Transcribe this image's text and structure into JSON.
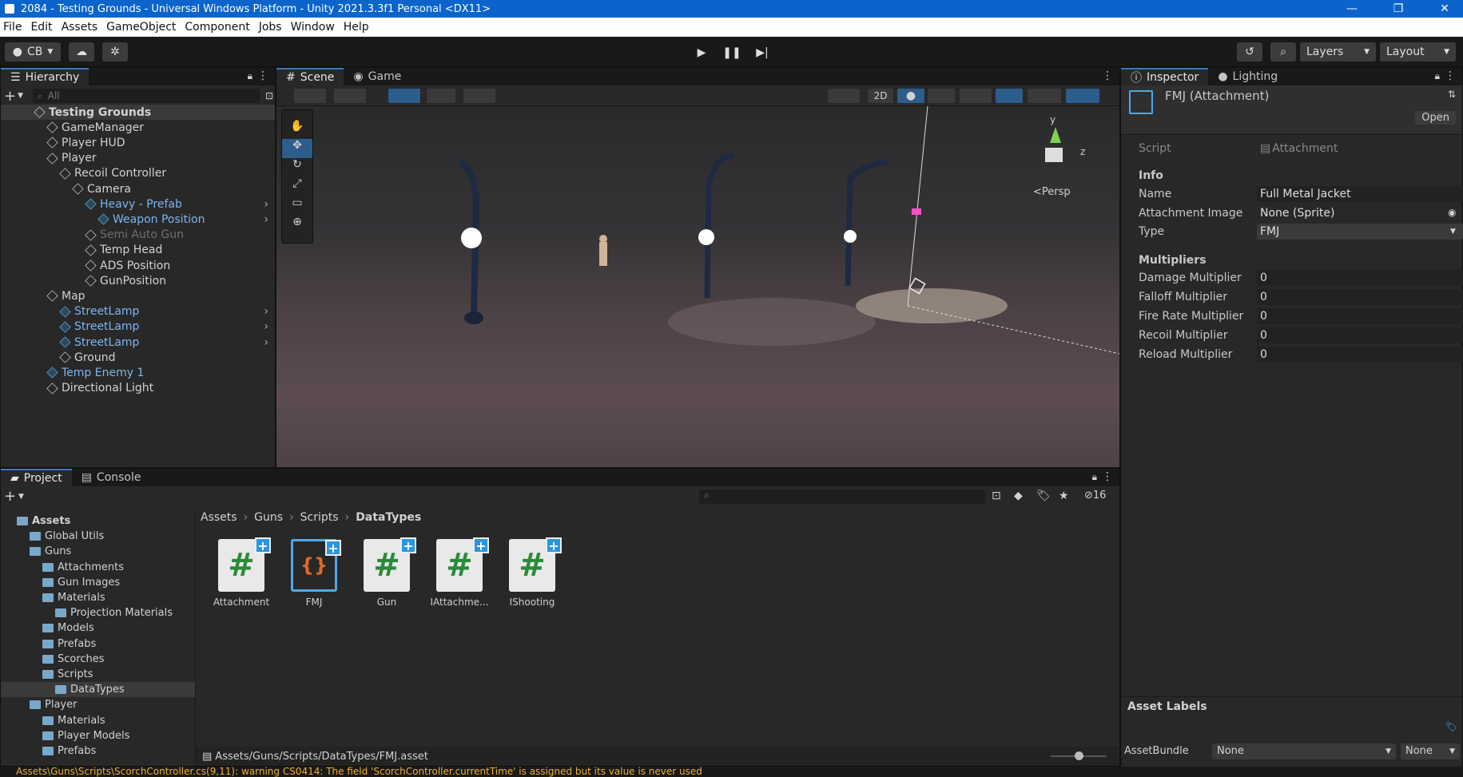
{
  "window": {
    "title": "2084 - Testing Grounds - Universal Windows Platform - Unity 2021.3.3f1 Personal <DX11>"
  },
  "menu": [
    "File",
    "Edit",
    "Assets",
    "GameObject",
    "Component",
    "Jobs",
    "Window",
    "Help"
  ],
  "toolbar": {
    "account": "CB",
    "layers": "Layers",
    "layout": "Layout"
  },
  "hierarchy": {
    "tab": "Hierarchy",
    "search_placeholder": "All",
    "rows": [
      {
        "label": "Testing Grounds",
        "depth": 0,
        "kind": "scene"
      },
      {
        "label": "GameManager",
        "depth": 1
      },
      {
        "label": "Player HUD",
        "depth": 1
      },
      {
        "label": "Player",
        "depth": 1
      },
      {
        "label": "Recoil Controller",
        "depth": 2
      },
      {
        "label": "Camera",
        "depth": 3
      },
      {
        "label": "Heavy - Prefab",
        "depth": 4,
        "kind": "prefab"
      },
      {
        "label": "Weapon Position",
        "depth": 5,
        "kind": "prefab"
      },
      {
        "label": "Semi Auto Gun",
        "depth": 4,
        "kind": "dim"
      },
      {
        "label": "Temp Head",
        "depth": 4
      },
      {
        "label": "ADS Position",
        "depth": 4
      },
      {
        "label": "GunPosition",
        "depth": 4
      },
      {
        "label": "Map",
        "depth": 1
      },
      {
        "label": "StreetLamp",
        "depth": 2,
        "kind": "prefab"
      },
      {
        "label": "StreetLamp",
        "depth": 2,
        "kind": "prefab"
      },
      {
        "label": "StreetLamp",
        "depth": 2,
        "kind": "prefab"
      },
      {
        "label": "Ground",
        "depth": 2
      },
      {
        "label": "Temp Enemy 1",
        "depth": 1,
        "kind": "prefab"
      },
      {
        "label": "Directional Light",
        "depth": 1
      }
    ]
  },
  "scene": {
    "tab_scene": "Scene",
    "tab_game": "Game",
    "mode_2d": "2D",
    "persp": "<Persp",
    "gizmo_y": "y",
    "gizmo_z": "z"
  },
  "inspector": {
    "tab": "Inspector",
    "tab_lighting": "Lighting",
    "object_title": "FMJ (Attachment)",
    "open_button": "Open",
    "script_label": "Script",
    "script_value": "Attachment",
    "info_header": "Info",
    "fields": [
      {
        "label": "Name",
        "value": "Full Metal Jacket"
      },
      {
        "label": "Attachment Image",
        "value": "None (Sprite)"
      },
      {
        "label": "Type",
        "value": "FMJ"
      }
    ],
    "multipliers_header": "Multipliers",
    "multipliers": [
      {
        "label": "Damage Multiplier",
        "value": "0"
      },
      {
        "label": "Falloff Multiplier",
        "value": "0"
      },
      {
        "label": "Fire Rate Multiplier",
        "value": "0"
      },
      {
        "label": "Recoil Multiplier",
        "value": "0"
      },
      {
        "label": "Reload Multiplier",
        "value": "0"
      }
    ],
    "asset_labels": "Asset Labels",
    "asset_bundle_label": "AssetBundle",
    "asset_bundle_value": "None",
    "asset_bundle_variant": "None"
  },
  "project": {
    "tab": "Project",
    "tab_console": "Console",
    "hidden_count": "16",
    "breadcrumb": [
      "Assets",
      "Guns",
      "Scripts",
      "DataTypes"
    ],
    "tree": [
      {
        "label": "Assets",
        "depth": 0
      },
      {
        "label": "Global Utils",
        "depth": 1
      },
      {
        "label": "Guns",
        "depth": 1
      },
      {
        "label": "Attachments",
        "depth": 2
      },
      {
        "label": "Gun Images",
        "depth": 2
      },
      {
        "label": "Materials",
        "depth": 2
      },
      {
        "label": "Projection Materials",
        "depth": 3
      },
      {
        "label": "Models",
        "depth": 2
      },
      {
        "label": "Prefabs",
        "depth": 2
      },
      {
        "label": "Scorches",
        "depth": 2
      },
      {
        "label": "Scripts",
        "depth": 2
      },
      {
        "label": "DataTypes",
        "depth": 3
      },
      {
        "label": "Player",
        "depth": 1
      },
      {
        "label": "Materials",
        "depth": 2
      },
      {
        "label": "Player Models",
        "depth": 2
      },
      {
        "label": "Prefabs",
        "depth": 2
      }
    ],
    "assets": [
      {
        "label": "Attachment",
        "kind": "script"
      },
      {
        "label": "FMJ",
        "kind": "scriptable"
      },
      {
        "label": "Gun",
        "kind": "script"
      },
      {
        "label": "IAttachme...",
        "kind": "script"
      },
      {
        "label": "IShooting",
        "kind": "script"
      }
    ],
    "path": "Assets/Guns/Scripts/DataTypes/FMJ.asset"
  },
  "status": "Assets\\Guns\\Scripts\\ScorchController.cs(9,11): warning CS0414: The field 'ScorchController.currentTime' is assigned but its value is never used"
}
